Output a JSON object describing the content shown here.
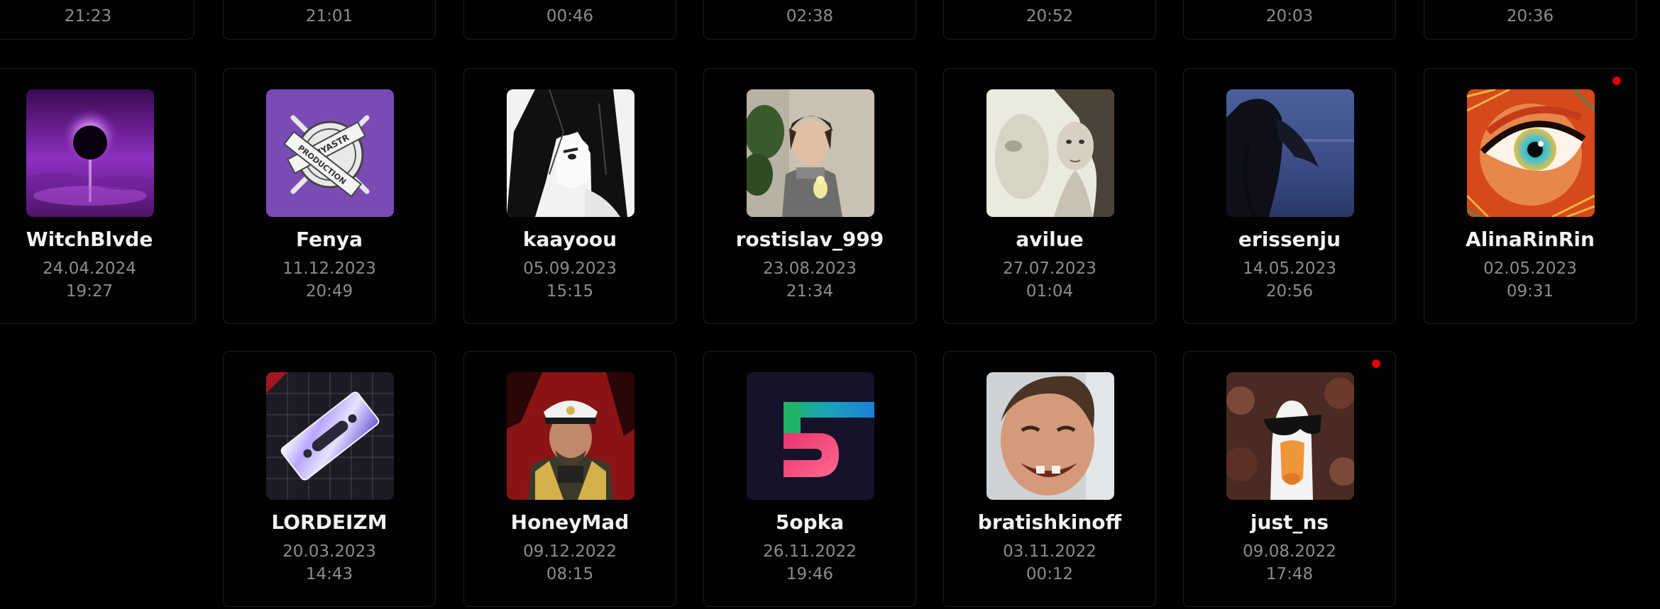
{
  "top_row": {
    "times": [
      "21:23",
      "21:01",
      "00:46",
      "02:38",
      "20:52",
      "20:03",
      "20:36"
    ]
  },
  "users": [
    {
      "name": "WitchBlvde",
      "date": "24.04.2024",
      "time": "19:27"
    },
    {
      "name": "Fenya",
      "date": "11.12.2023",
      "time": "20:49"
    },
    {
      "name": "kaayoou",
      "date": "05.09.2023",
      "time": "15:15"
    },
    {
      "name": "rostislav_999",
      "date": "23.08.2023",
      "time": "21:34"
    },
    {
      "name": "avilue",
      "date": "27.07.2023",
      "time": "01:04"
    },
    {
      "name": "erissenju",
      "date": "14.05.2023",
      "time": "20:56"
    },
    {
      "name": "AlinaRinRin",
      "date": "02.05.2023",
      "time": "09:31",
      "unread": true
    },
    {
      "name": "LORDEIZM",
      "date": "20.03.2023",
      "time": "14:43"
    },
    {
      "name": "HoneyMad",
      "date": "09.12.2022",
      "time": "08:15"
    },
    {
      "name": "5opka",
      "date": "26.11.2022",
      "time": "19:46"
    },
    {
      "name": "bratishkinoff",
      "date": "03.11.2022",
      "time": "00:12"
    },
    {
      "name": "just_ns",
      "date": "09.08.2022",
      "time": "17:48",
      "unread": true
    }
  ],
  "avatar_badges": {
    "fenya": [
      "FENYASTR",
      "PRODUCTION"
    ]
  },
  "colors": {
    "background": "#000000",
    "card_border": "#1e1e1e",
    "name_text": "#f2f2f2",
    "meta_text": "#8c8c8c",
    "notification_dot": "#e00000",
    "fenya_avatar": "#7a4bb5"
  },
  "icons": {
    "notification": "red-dot-icon"
  }
}
